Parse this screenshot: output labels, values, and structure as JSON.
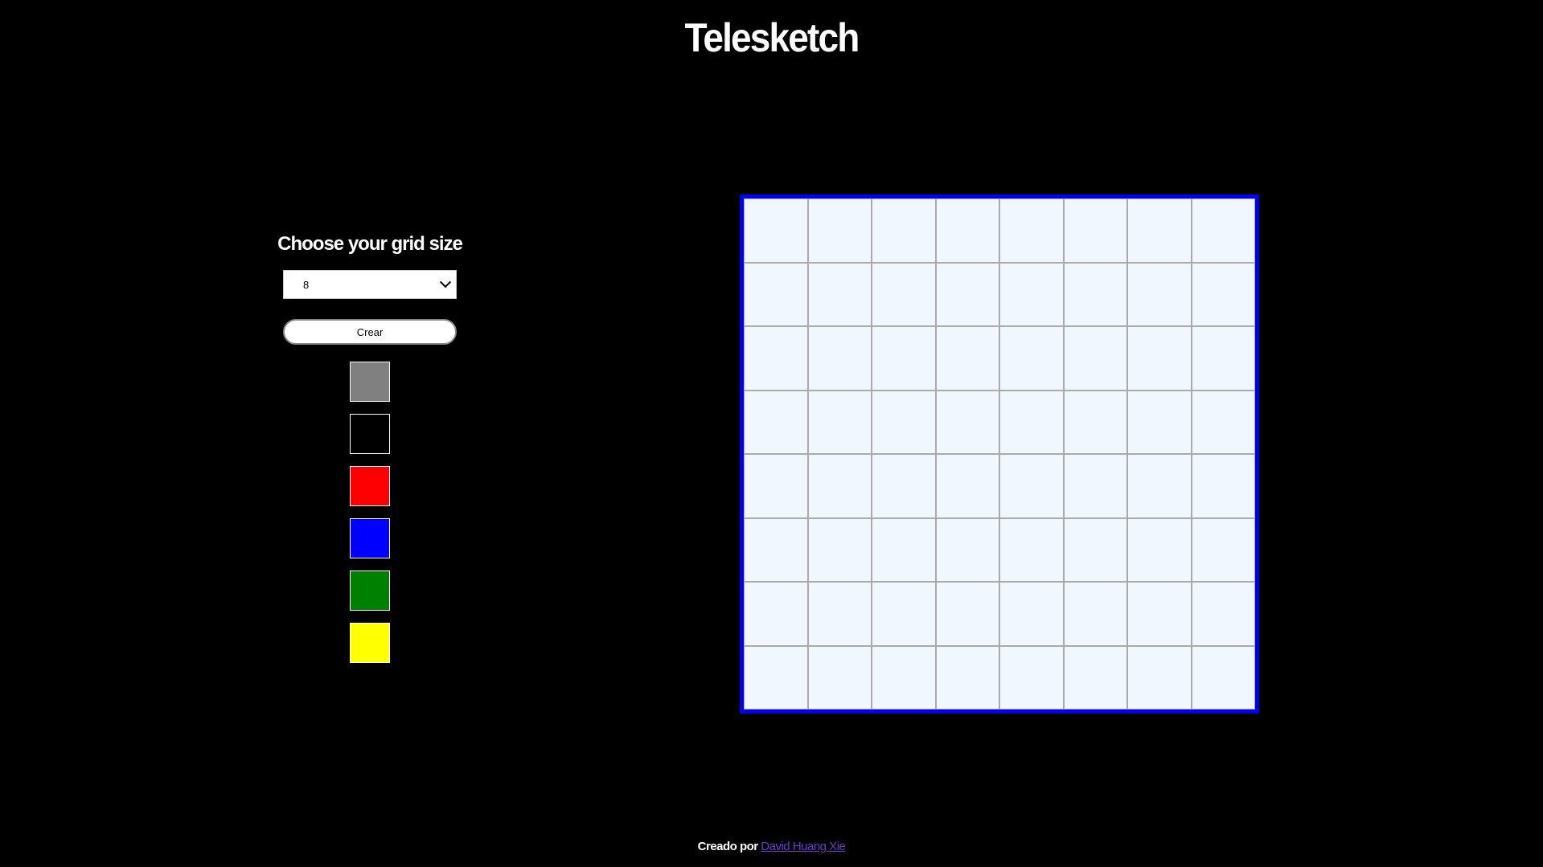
{
  "header": {
    "title": "Telesketch"
  },
  "controls": {
    "heading": "Choose your grid size",
    "grid_size": {
      "selected": "8"
    },
    "clear_label": "Crear",
    "swatches": [
      {
        "name": "gray",
        "color": "#808080"
      },
      {
        "name": "black",
        "color": "#000000"
      },
      {
        "name": "red",
        "color": "#ff0000"
      },
      {
        "name": "blue",
        "color": "#0000ff"
      },
      {
        "name": "green",
        "color": "#008000"
      },
      {
        "name": "yellow",
        "color": "#ffff00"
      }
    ]
  },
  "board": {
    "rows": 8,
    "columns": 8,
    "cell_color": "#f0f7ff",
    "border_color": "#0000ee"
  },
  "footer": {
    "prefix": "Creado por",
    "author_link": "David Huang Xie"
  }
}
